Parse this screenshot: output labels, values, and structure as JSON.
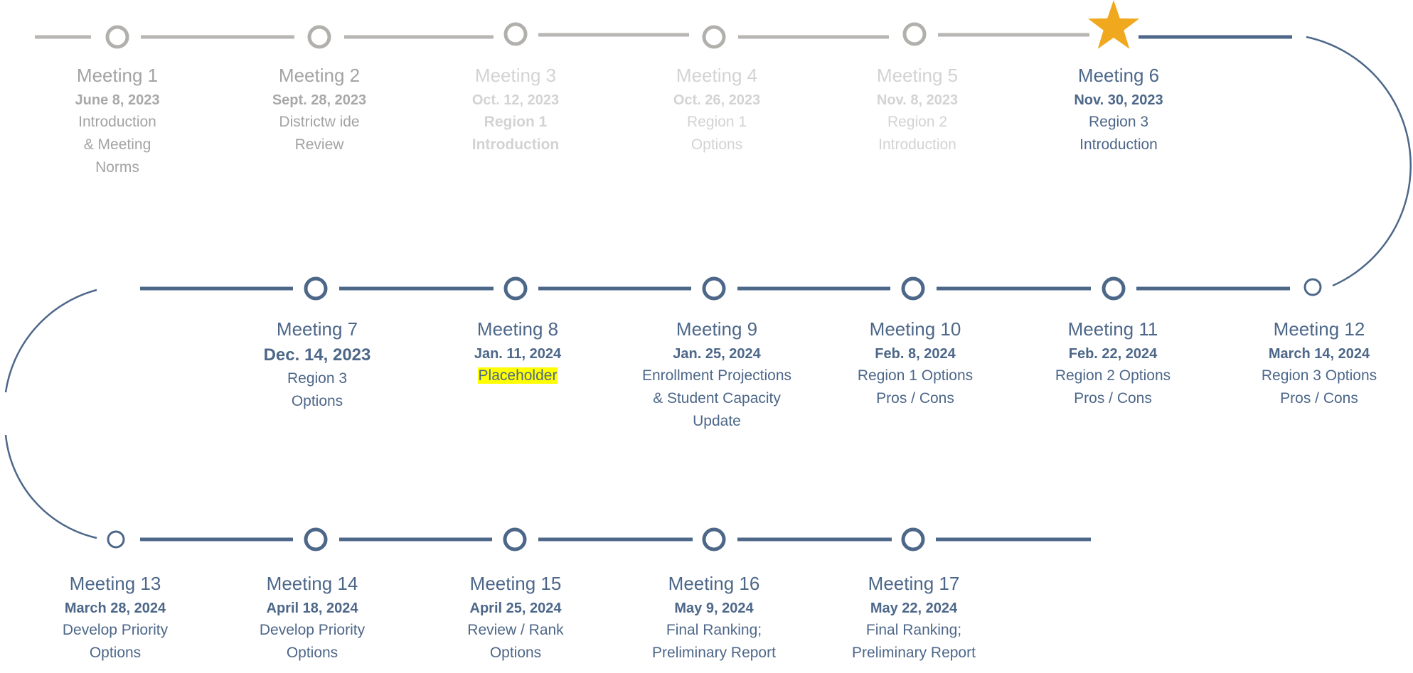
{
  "colors": {
    "past_line": "#b8b6b2",
    "past_node": "#b2b0ac",
    "past_text": "#a3a3a3",
    "faded_text": "#d3d3d3",
    "active": "#4d6789",
    "star": "#f0a81e",
    "highlight": "#ffff00"
  },
  "meetings": [
    {
      "title": "Meeting 1",
      "date": "June 8, 2023",
      "desc": "Introduction\n& Meeting\nNorms",
      "state": "past"
    },
    {
      "title": "Meeting 2",
      "date": "Sept. 28, 2023",
      "desc": "Districtw ide\nReview",
      "state": "past"
    },
    {
      "title": "Meeting 3",
      "date": "Oct. 12, 2023",
      "desc": "Region 1\nIntroduction",
      "state": "faded",
      "desc_bold": true
    },
    {
      "title": "Meeting 4",
      "date": "Oct. 26, 2023",
      "desc": "Region  1\nOptions",
      "state": "faded"
    },
    {
      "title": "Meeting 5",
      "date": "Nov. 8, 2023",
      "desc": "Region  2\nIntroduction",
      "state": "faded"
    },
    {
      "title": "Meeting 6",
      "date": "Nov. 30, 2023",
      "desc": "Region  3\nIntroduction",
      "state": "current"
    },
    {
      "title": "Meeting 7",
      "date": "Dec. 14, 2023",
      "desc": "Region  3\nOptions",
      "state": "future",
      "date_large": true
    },
    {
      "title": "Meeting 8",
      "date": "Jan. 11, 2024",
      "desc": "Placeholder",
      "state": "future",
      "highlight": true
    },
    {
      "title": "Meeting 9",
      "date": "Jan. 25, 2024",
      "desc": "Enrollment  Projections\n& Student  Capacity\nUpdate",
      "state": "future"
    },
    {
      "title": "Meeting 10",
      "date": "Feb. 8, 2024",
      "desc": "Region  1 Options\nPros  /  Cons",
      "state": "future"
    },
    {
      "title": "Meeting 11",
      "date": "Feb. 22, 2024",
      "desc": "Region  2 Options\nPros  /  Cons",
      "state": "future"
    },
    {
      "title": "Meeting 12",
      "date": "March 14, 2024",
      "desc": "Region  3 Options\nPros  /  Cons",
      "state": "future"
    },
    {
      "title": "Meeting 13",
      "date": "March 28, 2024",
      "desc": "Develop  Priority\nOptions",
      "state": "future"
    },
    {
      "title": "Meeting 14",
      "date": "April 18, 2024",
      "desc": "Develop  Priority\nOptions",
      "state": "future"
    },
    {
      "title": "Meeting 15",
      "date": "April 25, 2024",
      "desc": "Review  /  Rank\nOptions",
      "state": "future"
    },
    {
      "title": "Meeting 16",
      "date": "May 9, 2024",
      "desc": "Final  Ranking;\nPreliminary  Report",
      "state": "future"
    },
    {
      "title": "Meeting 17",
      "date": "May 22, 2024",
      "desc": "Final  Ranking;\nPreliminary  Report",
      "state": "future"
    }
  ]
}
